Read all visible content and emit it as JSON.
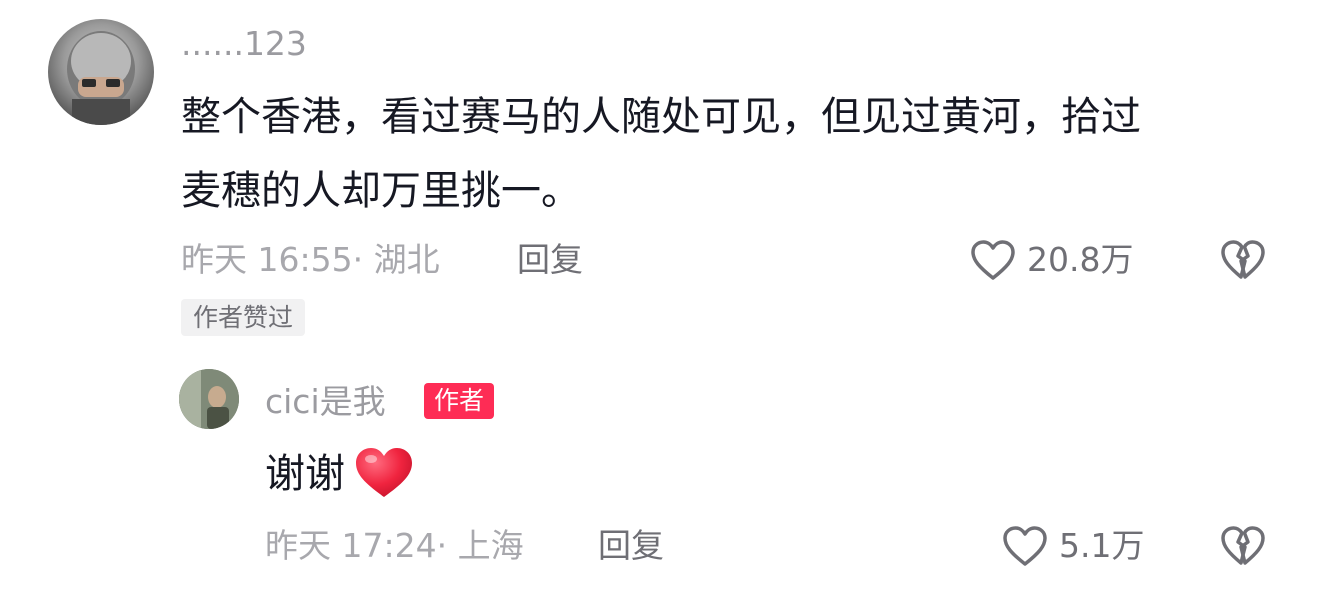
{
  "comment": {
    "username": "......123",
    "text_line1": "整个香港，看过赛马的人随处可见，但见过黄河，拾过",
    "text_line2": "麦穗的人却万里挑一。",
    "meta": "昨天 16:55· 湖北",
    "reply_label": "回复",
    "like_count": "20.8万",
    "liked_by_author_badge": "作者赞过"
  },
  "reply": {
    "username": "cici是我",
    "author_tag": "作者",
    "text": "谢谢",
    "emoji_icon": "red-heart-emoji",
    "meta": "昨天 17:24· 上海",
    "reply_label": "回复",
    "like_count": "5.1万"
  },
  "colors": {
    "primary_text": "#161823",
    "secondary_text": "#9b9ba0",
    "author_tag_bg": "#fe2c55",
    "heart_red": "#fe2c55"
  }
}
